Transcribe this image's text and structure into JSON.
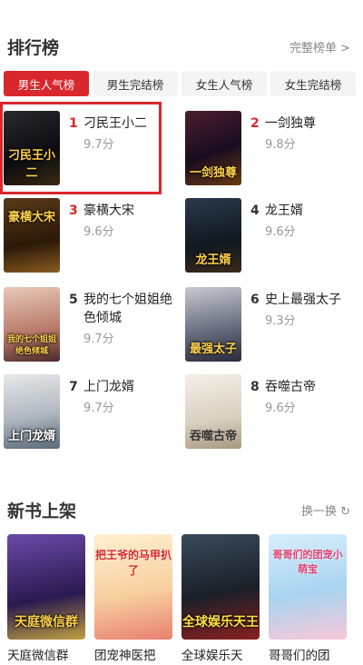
{
  "ranking": {
    "title": "排行榜",
    "more_label": "完整榜单 >",
    "tabs": [
      "男生人气榜",
      "男生完结榜",
      "女生人气榜",
      "女生完结榜"
    ],
    "books": [
      {
        "rank": "1",
        "title": "刁民王小二",
        "score": "9.7分",
        "cover_text": "刁民王小二"
      },
      {
        "rank": "2",
        "title": "一剑独尊",
        "score": "9.8分",
        "cover_text": "一剑独尊"
      },
      {
        "rank": "3",
        "title": "豪横大宋",
        "score": "9.6分",
        "cover_text": "豪横大宋"
      },
      {
        "rank": "4",
        "title": "龙王婿",
        "score": "9.6分",
        "cover_text": "龙王婿"
      },
      {
        "rank": "5",
        "title": "我的七个姐姐绝色倾城",
        "score": "9.7分",
        "cover_text": "我的七个姐姐绝色倾城"
      },
      {
        "rank": "6",
        "title": "史上最强太子",
        "score": "9.3分",
        "cover_text": "最强太子"
      },
      {
        "rank": "7",
        "title": "上门龙婿",
        "score": "9.7分",
        "cover_text": "上门龙婿"
      },
      {
        "rank": "8",
        "title": "吞噬古帝",
        "score": "9.6分",
        "cover_text": "吞噬古帝"
      }
    ]
  },
  "new_books": {
    "title": "新书上架",
    "refresh_label": "换一换",
    "books": [
      {
        "title": "天庭微信群",
        "cover_text": "天庭微信群"
      },
      {
        "title": "团宠神医把",
        "cover_text": "把王爷的马甲扒了"
      },
      {
        "title": "全球娱乐天",
        "cover_text": "全球娱乐天王"
      },
      {
        "title": "哥哥们的团",
        "cover_text": "哥哥们的团宠小萌宝"
      }
    ]
  },
  "colors": {
    "accent": "#d9272e",
    "tab_bg": "#f4f4f4",
    "muted": "#999999"
  }
}
